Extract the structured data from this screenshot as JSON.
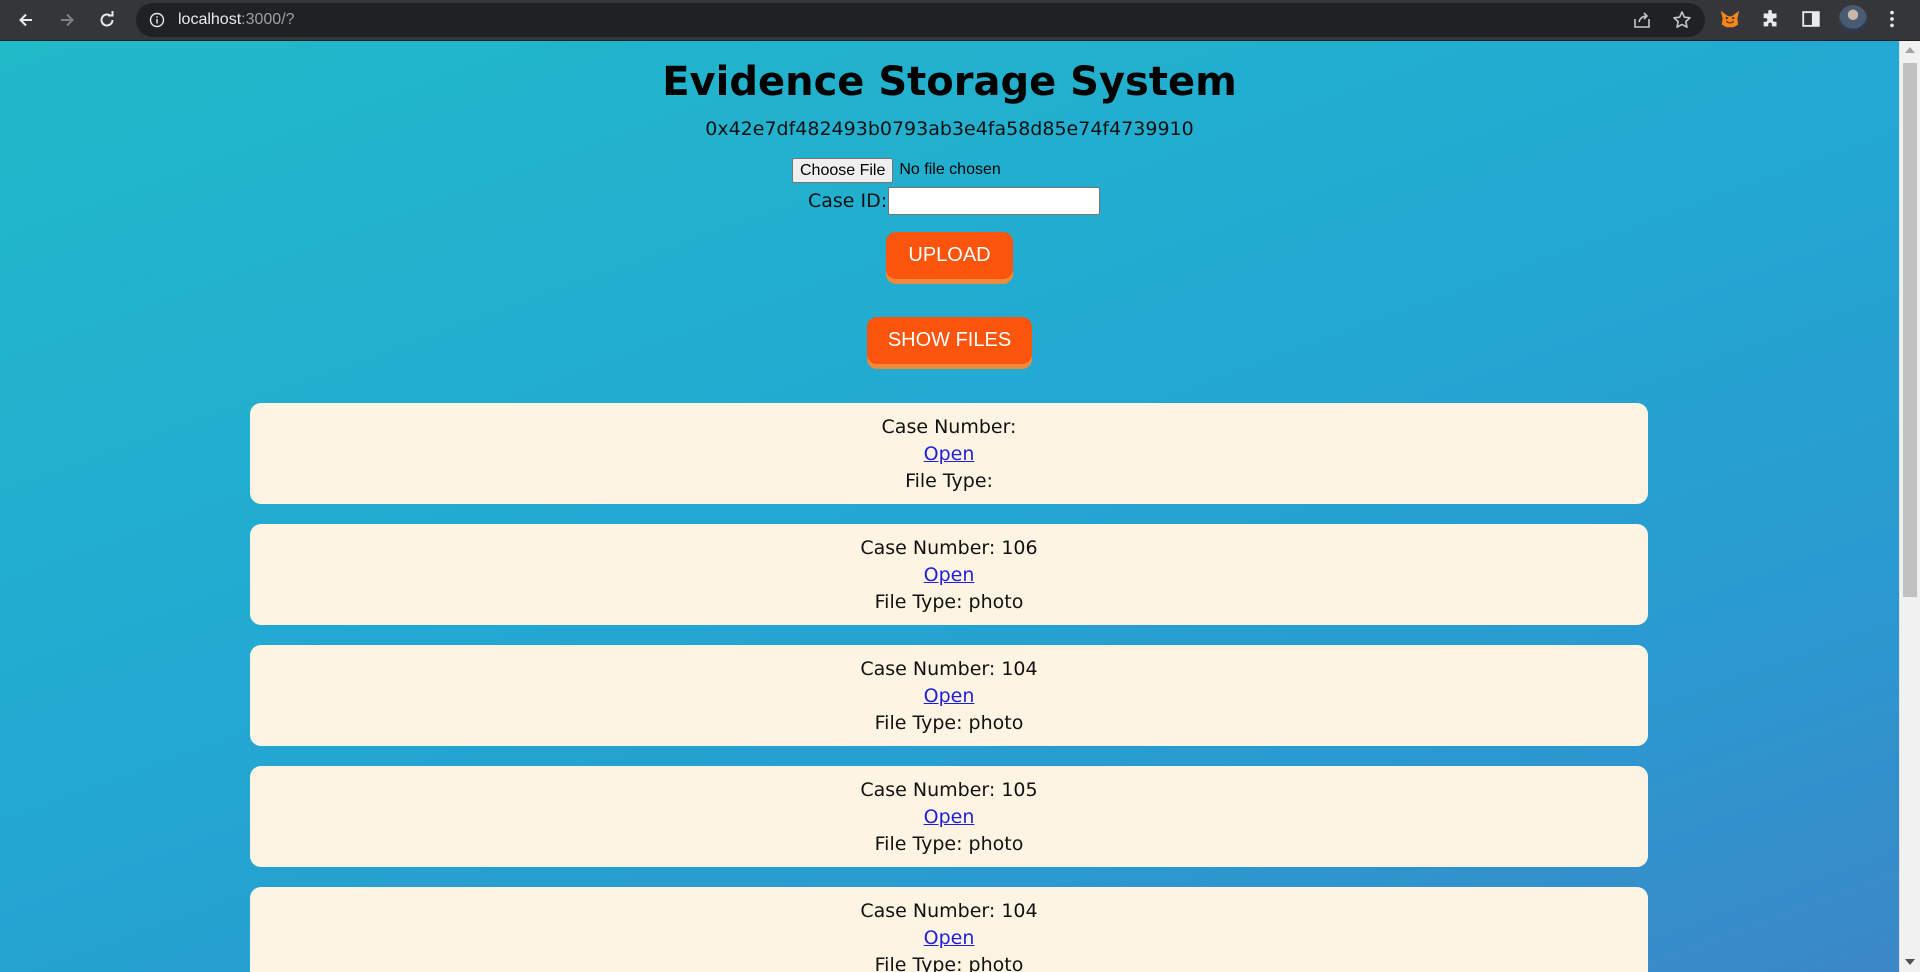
{
  "browser": {
    "url_host": "localhost",
    "url_rest": ":3000/?"
  },
  "page": {
    "title": "Evidence Storage System",
    "account_address": "0x42e7df482493b0793ab3e4fa58d85e74f4739910",
    "choose_file_label": "Choose File",
    "file_chosen_text": "No file chosen",
    "case_id_label": "Case ID:",
    "case_id_value": "",
    "upload_label": "UPLOAD",
    "show_files_label": "SHOW FILES"
  },
  "files": [
    {
      "case_number": "Case Number:",
      "link": "Open",
      "file_type": "File Type:"
    },
    {
      "case_number": "Case Number: 106",
      "link": "Open",
      "file_type": "File Type: photo"
    },
    {
      "case_number": "Case Number: 104",
      "link": "Open",
      "file_type": "File Type: photo"
    },
    {
      "case_number": "Case Number: 105",
      "link": "Open",
      "file_type": "File Type: photo"
    },
    {
      "case_number": "Case Number: 104",
      "link": "Open",
      "file_type": "File Type: photo"
    }
  ],
  "colors": {
    "button_orange": "#fb540c",
    "card_background": "#fdf4e3",
    "gradient_start": "#21bac9",
    "gradient_end": "#3b87c7"
  },
  "icons": [
    "back-arrow-icon",
    "forward-arrow-icon",
    "reload-icon",
    "info-icon",
    "share-icon",
    "star-icon",
    "fox-extension-icon",
    "puzzle-icon",
    "side-panel-icon",
    "kebab-menu-icon"
  ]
}
